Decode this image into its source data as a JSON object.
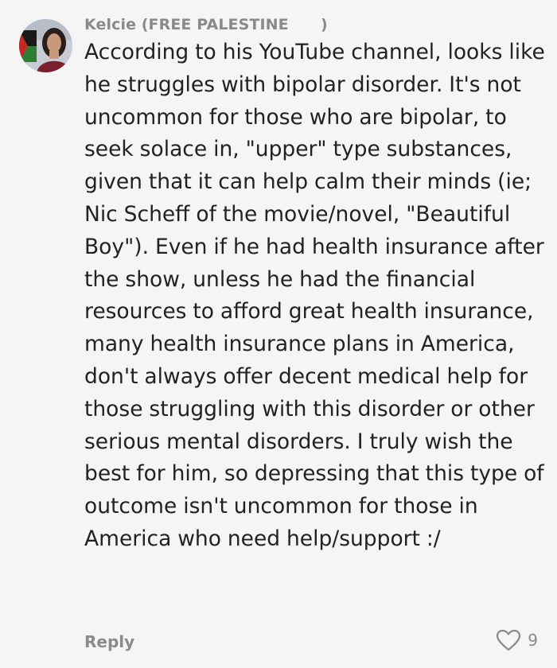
{
  "comment": {
    "username": "Kelcie (FREE PALESTINE      )",
    "text": "According to his YouTube channel, looks like he struggles with bipolar disorder. It's not uncommon for those who are bipolar, to seek solace in, \"upper\" type substances, given that it can help calm their minds (ie; Nic Scheff of the movie/novel, \"Beautiful Boy\"). Even if he had health insurance after the show, unless he had the financial resources to afford great health insurance, many health insurance plans in America, don't always offer decent medical help for those struggling with this disorder or other serious mental disorders. I truly wish the best for him, so depressing that this type of outcome isn't uncommon for those in America who need help/support :/",
    "reply_label": "Reply",
    "like_count": "9",
    "like_icon": "heart-outline-icon"
  },
  "colors": {
    "background": "#f5f5f5",
    "meta_text": "#8a8a8a",
    "body_text": "#222222"
  }
}
